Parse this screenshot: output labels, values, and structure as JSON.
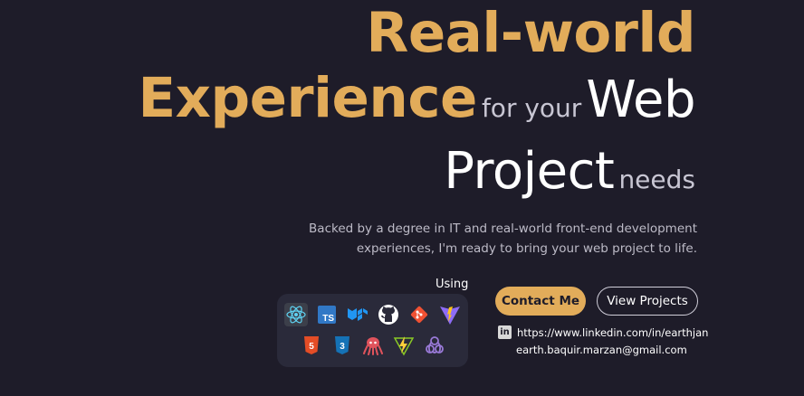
{
  "hero": {
    "real_world": "Real-world",
    "experience": "Experience",
    "for_your": "for your",
    "web": "Web",
    "project": "Project",
    "needs": "needs"
  },
  "description": "Backed by a degree in IT and real-world front-end development experiences, I'm ready to bring your web project to life.",
  "tech": {
    "using_label": "Using",
    "ts_text": "TS",
    "html_text": "5",
    "css_text": "3",
    "icons_row1": [
      "react-icon",
      "typescript-icon",
      "material-ui-icon",
      "github-icon",
      "git-icon",
      "vite-icon"
    ],
    "icons_row2": [
      "html5-icon",
      "css3-icon",
      "octopus-icon",
      "zustand-bolt-icon",
      "redux-icon"
    ]
  },
  "buttons": {
    "contact": "Contact Me",
    "projects": "View Projects"
  },
  "contacts": {
    "linkedin_icon": "in",
    "linkedin": "https://www.linkedin.com/in/earthjan",
    "email": "earth.baquir.marzan@gmail.com"
  },
  "colors": {
    "background": "#1e1c29",
    "gold": "#e2ac5a",
    "panel": "#2a2a3a"
  }
}
